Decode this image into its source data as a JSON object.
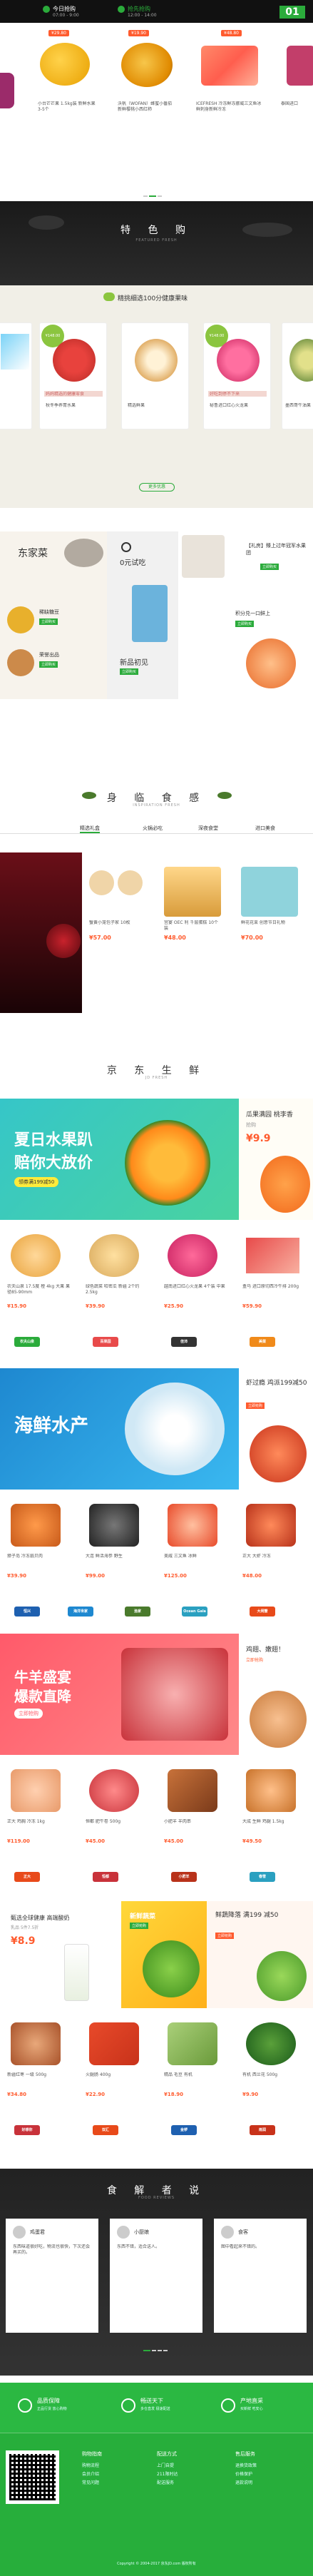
{
  "top": {
    "slot1": {
      "title": "今日抢购",
      "time": "07:00 - 9:00"
    },
    "slot2": {
      "title": "抢先抢购",
      "time": "12:00 - 14:00"
    },
    "page_num": "01",
    "products": [
      {
        "price": "¥29.80",
        "name": "小台芒芒果 1.5kg装 新鲜水果3-5个"
      },
      {
        "price": "¥19.90",
        "name": "沃帆（WOFAN）蜂蜜小番茄新鲜樱桃小西红柿"
      },
      {
        "price": "¥48.80",
        "name": "ICEFRESH 冷冻鲜冻挪威三文鱼冰鲜刺身新鲜冷冻"
      },
      {
        "price": "",
        "name": "泰国进口"
      }
    ]
  },
  "featured": {
    "title": "特 色 购",
    "subtitle": "FEATURED FRESH",
    "banner": "精挑细选100分健康果味",
    "cards": [
      {
        "badge": "¥148.00",
        "name": "秋冬季养胃水果",
        "desc": "鲜果健康精选"
      },
      {
        "badge": "",
        "name": "妈妈精选的健康零食",
        "desc": "精选鲜果"
      },
      {
        "badge": "¥148.00",
        "name": "秘鲁进口红心火龙果",
        "desc": "好吃到停不下来"
      },
      {
        "badge": "",
        "name": "墨西哥牛油果",
        "desc": "鲜果"
      }
    ],
    "more": "更多优惠"
  },
  "promo": {
    "east": {
      "title": "东家菜",
      "items": [
        {
          "label": "稀缺糖豆",
          "btn": "立即购买"
        },
        {
          "label": "荣誉出品",
          "btn": "立即购买"
        }
      ]
    },
    "zero": {
      "title": "0元试吃",
      "sub": "新品初见",
      "btn": "立即购买"
    },
    "right": {
      "title": "【礼房】臻上过年冠军水果团",
      "btn1": "立即购买",
      "label": "积分兑一口鲜上",
      "btn2": "立即购买"
    }
  },
  "inspiration": {
    "title": "身 临 食 感",
    "subtitle": "INSPIRATION FRESH",
    "tabs": [
      "精选礼盒",
      "火锅必吃",
      "深夜食堂",
      "进口美食"
    ],
    "items": [
      {
        "name": "蟹黄小笼包子家 10枚",
        "price": "¥57.00"
      },
      {
        "name": "宫宴 OEC 利 千层蛋糕 10个装",
        "price": "¥48.00"
      },
      {
        "name": "鲜花花束 创意节日礼物",
        "price": "¥70.00"
      }
    ]
  },
  "jd_fresh": {
    "title": "京 东 生 鲜",
    "subtitle": "JD FRESH",
    "banner1": {
      "line1": "夏日水果趴",
      "line2": "赔你大放价",
      "btn": "领券满199减50"
    },
    "side1": {
      "title": "瓜果满园 桃李香",
      "sub": "抢购",
      "price": "¥9.9"
    },
    "row1": [
      {
        "name": "农夫山泉 17.5度 橙 4kg 大果 果径85-90mm",
        "price": "¥15.90"
      },
      {
        "name": "绿色蔬菜 哈密瓜 新疆 2个约2.5kg",
        "price": "¥39.90"
      },
      {
        "name": "越南进口红心火龙果 4个装 中果",
        "price": "¥25.90"
      },
      {
        "name": "盒马 进口原切西冷牛排 200g",
        "price": "¥59.90"
      }
    ],
    "logos1": [
      "农夫山泉",
      "百果园",
      "佳沛",
      "美菜"
    ],
    "banner2": {
      "line1": "海鲜水产"
    },
    "side2": {
      "title": "虾过瘾 鸡派199减50",
      "btn": "立即抢购"
    },
    "row2": [
      {
        "name": "獐子岛 冷冻扇贝肉",
        "price": "¥39.90"
      },
      {
        "name": "大连 鲜活海参 野生",
        "price": "¥99.00"
      },
      {
        "name": "美威 三文鱼 冰鲜",
        "price": "¥125.00"
      },
      {
        "name": "正大 大虾 冷冻",
        "price": "¥48.00"
      }
    ],
    "logos2": [
      "恒兴",
      "海洋世家",
      "渔家",
      "Ocean Gala",
      "大闸蟹"
    ],
    "banner3": {
      "line1": "牛羊盛宴",
      "line2": "爆款直降",
      "btn": "立即抢购"
    },
    "side3": {
      "title": "鸡翅、嫩翅！",
      "btn": "立即抢购"
    },
    "row3": [
      {
        "name": "正大 鸡胸 冷冻 1kg",
        "price": "¥119.00"
      },
      {
        "name": "恒都 肥牛卷 500g",
        "price": "¥45.00"
      },
      {
        "name": "小肥羊 羊肉串",
        "price": "¥45.00"
      },
      {
        "name": "大成 生鲜 鸡腿 1.5kg",
        "price": "¥49.50"
      }
    ],
    "logos3": [
      "正大",
      "恒都",
      "小肥羊",
      "春雪"
    ],
    "panel4a": {
      "title": "甄选全球健康 高端酸奶",
      "sub": "乳品 5件7.5折",
      "price": "¥8.9"
    },
    "panel4b": {
      "title": "新鲜蔬菜",
      "btn": "立即抢购"
    },
    "panel4c": {
      "title": "鲜蔬降落 满199 减50",
      "btn": "立即抢购"
    },
    "row4": [
      {
        "name": "新疆红枣 一级 500g",
        "price": "¥34.80"
      },
      {
        "name": "火腿肠 400g",
        "price": "¥22.90"
      },
      {
        "name": "精品 毛豆 有机",
        "price": "¥18.90"
      },
      {
        "name": "有机 西兰花 500g",
        "price": "¥9.90"
      }
    ],
    "logos4": [
      "好想你",
      "双汇",
      "金锣",
      "雨润"
    ]
  },
  "reviews": {
    "title": "食 解 者 说",
    "subtitle": "FOOD REVIEWS",
    "items": [
      {
        "author": "鸡蛋君",
        "text": "东西味道很好吃，物流也很快，下次还会再买的。"
      },
      {
        "author": "小厨娘",
        "text": "东西不错，适合送人。"
      },
      {
        "author": "食客",
        "text": "图中看起来不错的。"
      }
    ]
  },
  "footer": {
    "features": [
      {
        "title": "品质保障",
        "sub": "正品行货 放心购物"
      },
      {
        "title": "畅送天下",
        "sub": "多仓直发 极速配送"
      },
      {
        "title": "产地直采",
        "sub": "买新鲜 吃安心"
      }
    ],
    "cols": [
      {
        "title": "购物指南",
        "items": [
          "购物流程",
          "会员介绍",
          "常见问题"
        ]
      },
      {
        "title": "配送方式",
        "items": [
          "上门自提",
          "211限时达",
          "配送服务"
        ]
      },
      {
        "title": "售后服务",
        "items": [
          "退换货政策",
          "价格保护",
          "退款说明"
        ]
      }
    ],
    "copyright": "Copyright © 2004-2017 京东JD.com 版权所有"
  }
}
